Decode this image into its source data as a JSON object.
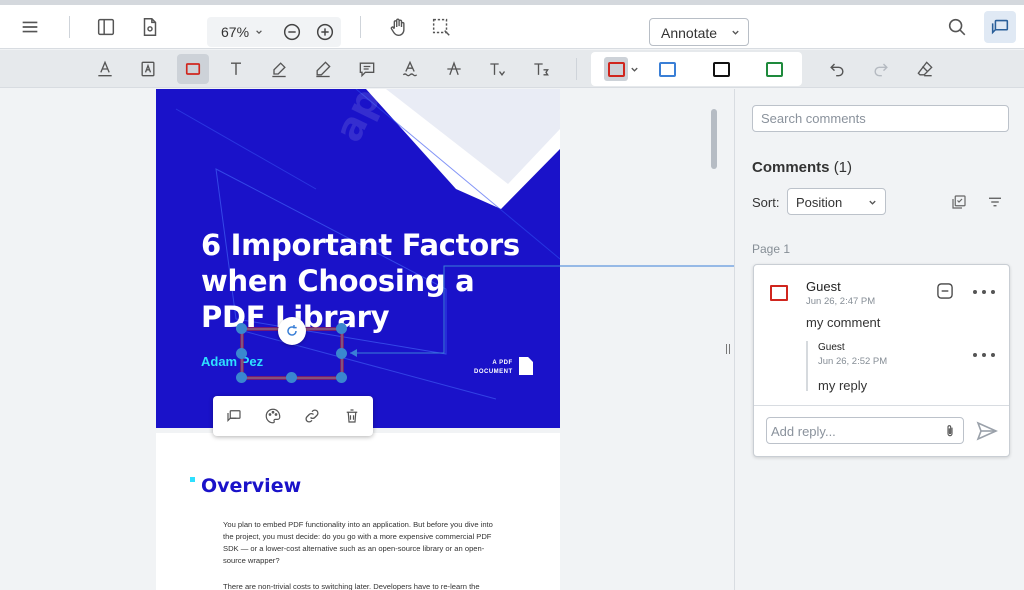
{
  "header": {
    "zoom": "67%",
    "mode": "Annotate"
  },
  "document": {
    "cover_title": "6 Important Factors when Choosing a PDF Library",
    "author": "Adam Pez",
    "watermark": "apryse",
    "doc_label_line1": "A PDF",
    "doc_label_line2": "DOCUMENT",
    "section_heading": "Overview",
    "paragraph1": "You plan to embed PDF functionality into an application. But before you dive into the project, you must decide: do you go with a more expensive commercial PDF SDK — or a lower-cost alternative such as an open-source library or an open-source wrapper?",
    "paragraph2": "There are non-trivial costs to switching later. Developers have to re-learn the"
  },
  "notes_panel": {
    "search_placeholder": "Search comments",
    "title": "Comments",
    "count": "(1)",
    "sort_label": "Sort:",
    "sort_value": "Position",
    "page_label": "Page 1",
    "note": {
      "author": "Guest",
      "date": "Jun 26, 2:47 PM",
      "content": "my comment",
      "icon_color": "#d0261e",
      "reply": {
        "author": "Guest",
        "date": "Jun 26, 2:52 PM",
        "content": "my reply"
      },
      "reply_placeholder": "Add reply..."
    }
  },
  "colors": {
    "accent": "#3a7fd6",
    "annotation_red": "#d0261e",
    "cover_blue": "#1a12c9",
    "preset_red": "#d0261e",
    "preset_blue": "#3a7fd6",
    "preset_black": "#111111",
    "preset_green": "#1e8a3c"
  }
}
